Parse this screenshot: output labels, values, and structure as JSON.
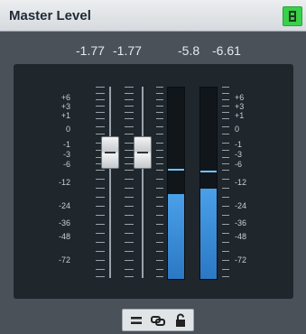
{
  "window": {
    "title": "Master Level",
    "pin_icon": "window-layout-icon"
  },
  "readouts": [
    "-1.77",
    "-1.77",
    "-5.8",
    "-6.61"
  ],
  "scale_labels": [
    "+6",
    "+3",
    "+1",
    "0",
    "-1",
    "-3",
    "-6",
    "-12",
    "-24",
    "-36",
    "-48",
    "-72"
  ],
  "faders": [
    {
      "name": "left-fader",
      "value_db": "-1.77"
    },
    {
      "name": "right-fader",
      "value_db": "-1.77"
    }
  ],
  "meters": [
    {
      "name": "left-meter",
      "level_db": -24,
      "peak_db": "-5.8"
    },
    {
      "name": "right-meter",
      "level_db": -22,
      "peak_db": "-6.61"
    }
  ],
  "footer": {
    "buttons": [
      {
        "name": "equal-icon",
        "glyph": "="
      },
      {
        "name": "link-icon",
        "glyph": "⛓"
      },
      {
        "name": "lock-icon",
        "glyph": "🔓"
      }
    ]
  },
  "colors": {
    "title_button": "#39d04a",
    "meter_fill": "#2b78c4",
    "background": "#4a5158"
  }
}
